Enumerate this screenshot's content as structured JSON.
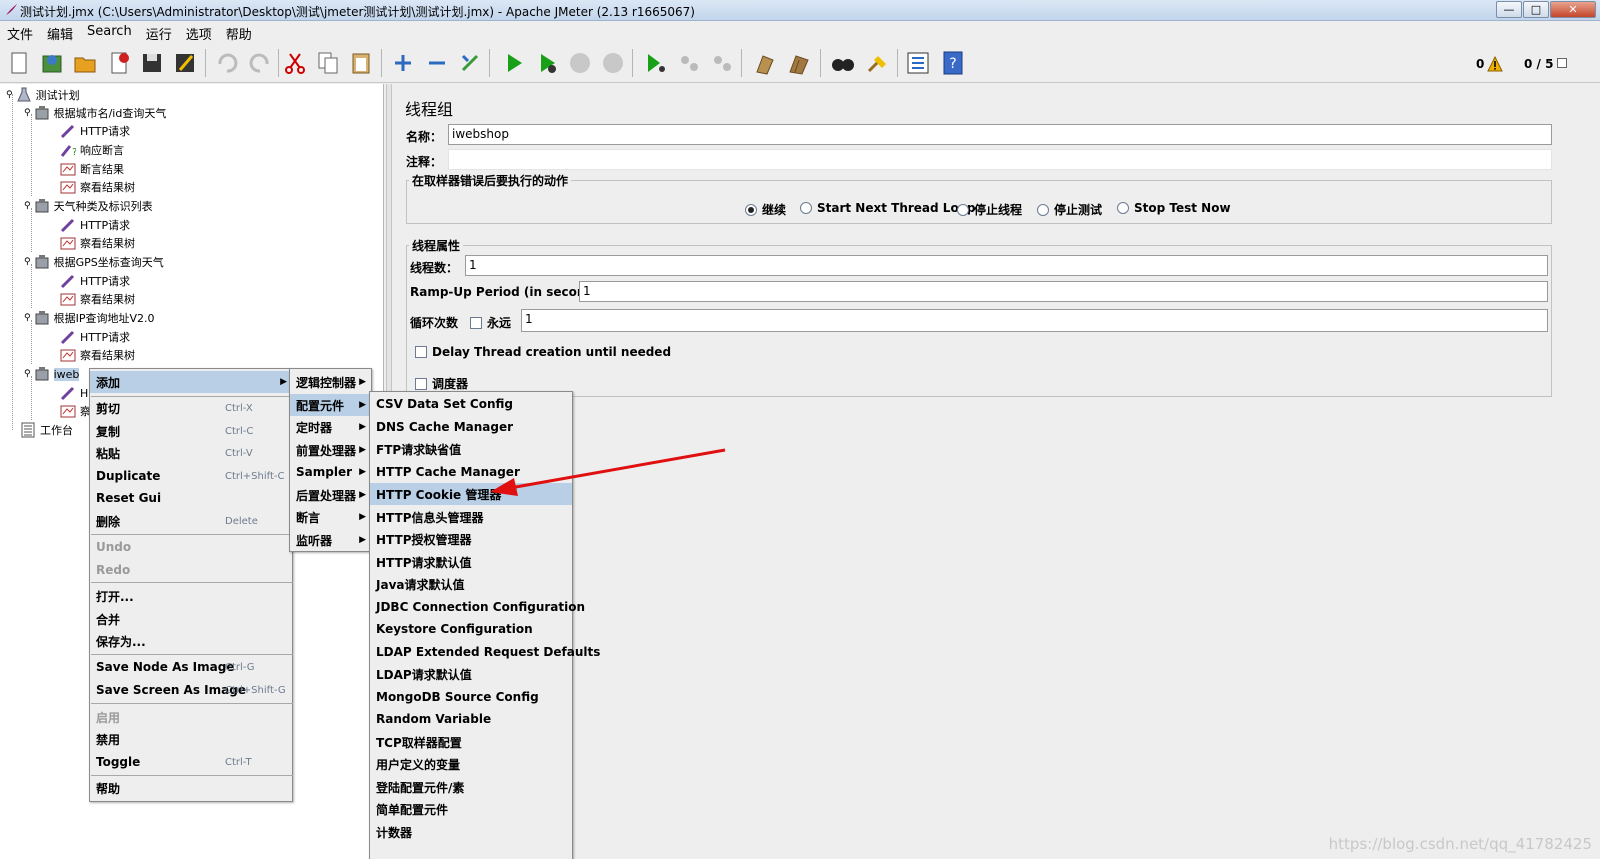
{
  "window": {
    "title": "测试计划.jmx (C:\\Users\\Administrator\\Desktop\\测试\\jmeter测试计划\\测试计划.jmx) - Apache JMeter (2.13 r1665067)",
    "minimize": "—",
    "maximize": "□",
    "close": "✕"
  },
  "menubar": [
    "文件",
    "编辑",
    "Search",
    "运行",
    "选项",
    "帮助"
  ],
  "toolbar": {
    "icons": [
      "new-icon",
      "templates-icon",
      "open-icon",
      "close-icon",
      "save-icon",
      "save-as-icon",
      "undo-icon",
      "redo-icon",
      "cut-icon",
      "copy-icon",
      "paste-icon",
      "expand-icon",
      "collapse-icon",
      "toggle-icon",
      "start-icon",
      "start-no-pause-icon",
      "stop-icon",
      "shutdown-icon",
      "remote-start-icon",
      "remote-stop-icon",
      "remote-exit-icon",
      "clear-icon",
      "clear-all-icon",
      "search-icon",
      "reset-search-icon",
      "function-helper-icon",
      "help-icon"
    ],
    "error_count": "0",
    "thread_count": "0 / 5"
  },
  "tree": {
    "nodes": [
      {
        "label": "测试计划",
        "icon": "test-plan-icon"
      },
      {
        "label": "根据城市名/id查询天气",
        "icon": "thread-group-icon"
      },
      {
        "label": "HTTP请求",
        "icon": "sampler-icon"
      },
      {
        "label": "响应断言",
        "icon": "assertion-icon"
      },
      {
        "label": "断言结果",
        "icon": "listener-icon"
      },
      {
        "label": "察看结果树",
        "icon": "listener-icon"
      },
      {
        "label": "天气种类及标识列表",
        "icon": "thread-group-icon"
      },
      {
        "label": "HTTP请求",
        "icon": "sampler-icon"
      },
      {
        "label": "察看结果树",
        "icon": "listener-icon"
      },
      {
        "label": "根据GPS坐标查询天气",
        "icon": "thread-group-icon"
      },
      {
        "label": "HTTP请求",
        "icon": "sampler-icon"
      },
      {
        "label": "察看结果树",
        "icon": "listener-icon"
      },
      {
        "label": "根据IP查询地址V2.0",
        "icon": "thread-group-icon"
      },
      {
        "label": "HTTP请求",
        "icon": "sampler-icon"
      },
      {
        "label": "察看结果树",
        "icon": "listener-icon"
      },
      {
        "label": "iweb",
        "icon": "thread-group-icon"
      },
      {
        "label": "H",
        "icon": "sampler-icon"
      },
      {
        "label": "察",
        "icon": "listener-icon"
      },
      {
        "label": "工作台",
        "icon": "workbench-icon"
      }
    ]
  },
  "panel": {
    "title": "线程组",
    "name_label": "名称：",
    "name_value": "iwebshop",
    "comment_label": "注释：",
    "comment_value": "",
    "on_error_legend": "在取样器错误后要执行的动作",
    "on_error_options": [
      "继续",
      "Start Next Thread Loop",
      "停止线程",
      "停止测试",
      "Stop Test Now"
    ],
    "on_error_selected": "继续",
    "props_legend": "线程属性",
    "threads_label": "线程数：",
    "threads_value": "1",
    "rampup_label": "Ramp-Up Period (in seconds):",
    "rampup_value": "1",
    "loop_label": "循环次数",
    "forever_label": "永远",
    "loop_value": "1",
    "delay_label": "Delay Thread creation until needed",
    "scheduler_label": "调度器"
  },
  "context_menu": {
    "items": [
      {
        "label": "添加",
        "accel": "",
        "submenu": true,
        "highlighted": true
      },
      {
        "label": "剪切",
        "accel": "Ctrl-X"
      },
      {
        "label": "复制",
        "accel": "Ctrl-C"
      },
      {
        "label": "粘贴",
        "accel": "Ctrl-V"
      },
      {
        "label": "Duplicate",
        "accel": "Ctrl+Shift-C"
      },
      {
        "label": "Reset Gui",
        "accel": ""
      },
      {
        "label": "删除",
        "accel": "Delete"
      },
      {
        "label": "Undo",
        "accel": "",
        "disabled": true
      },
      {
        "label": "Redo",
        "accel": "",
        "disabled": true
      },
      {
        "label": "打开...",
        "accel": ""
      },
      {
        "label": "合并",
        "accel": ""
      },
      {
        "label": "保存为...",
        "accel": ""
      },
      {
        "label": "Save Node As Image",
        "accel": "Ctrl-G"
      },
      {
        "label": "Save Screen As Image",
        "accel": "Ctrl+Shift-G"
      },
      {
        "label": "启用",
        "accel": "",
        "disabled": true
      },
      {
        "label": "禁用",
        "accel": ""
      },
      {
        "label": "Toggle",
        "accel": "Ctrl-T"
      },
      {
        "label": "帮助",
        "accel": ""
      }
    ]
  },
  "add_submenu": {
    "items": [
      "逻辑控制器",
      "配置元件",
      "定时器",
      "前置处理器",
      "Sampler",
      "后置处理器",
      "断言",
      "监听器"
    ],
    "highlighted": "配置元件"
  },
  "config_submenu": {
    "items": [
      "CSV Data Set Config",
      "DNS Cache Manager",
      "FTP请求缺省值",
      "HTTP Cache Manager",
      "HTTP Cookie 管理器",
      "HTTP信息头管理器",
      "HTTP授权管理器",
      "HTTP请求默认值",
      "Java请求默认值",
      "JDBC Connection Configuration",
      "Keystore Configuration",
      "LDAP Extended Request Defaults",
      "LDAP请求默认值",
      "MongoDB Source Config",
      "Random Variable",
      "TCP取样器配置",
      "用户定义的变量",
      "登陆配置元件/素",
      "简单配置元件",
      "计数器"
    ],
    "highlighted": "HTTP Cookie 管理器"
  },
  "watermark": "https://blog.csdn.net/qq_41782425",
  "colors": {
    "highlight": "#b8cfe5",
    "arrow": "#e01010"
  }
}
